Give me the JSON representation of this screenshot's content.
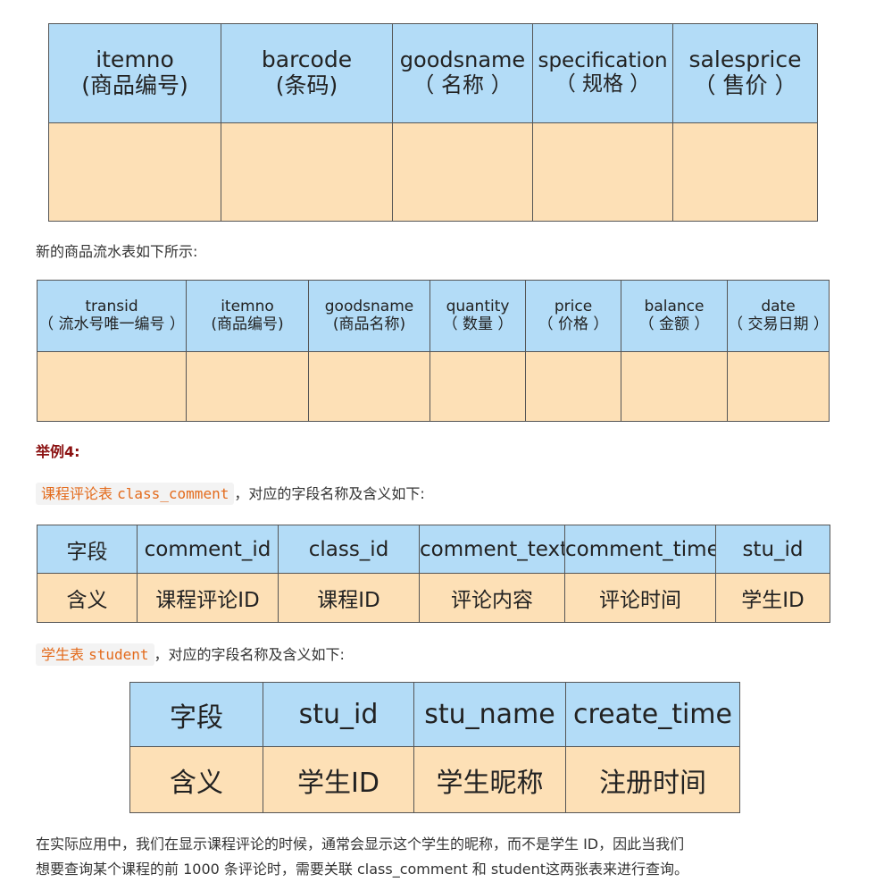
{
  "table1": {
    "headers": [
      {
        "en": "itemno",
        "zh": "(商品编号)"
      },
      {
        "en": "barcode",
        "zh": "(条码)"
      },
      {
        "en": "goodsname",
        "zh": "（ 名称 ）"
      },
      {
        "en": "specification",
        "zh": "（ 规格 ）"
      },
      {
        "en": "salesprice",
        "zh": "（ 售价 ）"
      }
    ]
  },
  "para1": "新的商品流水表如下所示:",
  "table2": {
    "headers": [
      {
        "en": "transid",
        "zh": "（ 流水号唯一编号 ）"
      },
      {
        "en": "itemno",
        "zh": "(商品编号)"
      },
      {
        "en": "goodsname",
        "zh": "(商品名称)"
      },
      {
        "en": "quantity",
        "zh": "（ 数量 ）"
      },
      {
        "en": "price",
        "zh": "（ 价格 ）"
      },
      {
        "en": "balance",
        "zh": "（ 金额 ）"
      },
      {
        "en": "date",
        "zh": "（ 交易日期 ）"
      }
    ]
  },
  "example_label": "举例4:",
  "para2": {
    "code_zh": "课程评论表",
    "code_en": "class_comment",
    "rest": "，对应的字段名称及含义如下:"
  },
  "table3": {
    "header_row": [
      "字段",
      "comment_id",
      "class_id",
      "comment_text",
      "comment_time",
      "stu_id"
    ],
    "body_row": [
      "含义",
      "课程评论ID",
      "课程ID",
      "评论内容",
      "评论时间",
      "学生ID"
    ]
  },
  "para3": {
    "code_zh": "学生表",
    "code_en": "student",
    "rest": "，对应的字段名称及含义如下:"
  },
  "table4": {
    "header_row": [
      "字段",
      "stu_id",
      "stu_name",
      "create_time"
    ],
    "body_row": [
      "含义",
      "学生ID",
      "学生昵称",
      "注册时间"
    ]
  },
  "para4": {
    "line1": "在实际应用中，我们在显示课程评论的时候，通常会显示这个学生的昵称，而不是学生 ID，因此当我们",
    "line2": "想要查询某个课程的前 1000 条评论时，需要关联 class_comment 和 student这两张表来进行查询。"
  }
}
